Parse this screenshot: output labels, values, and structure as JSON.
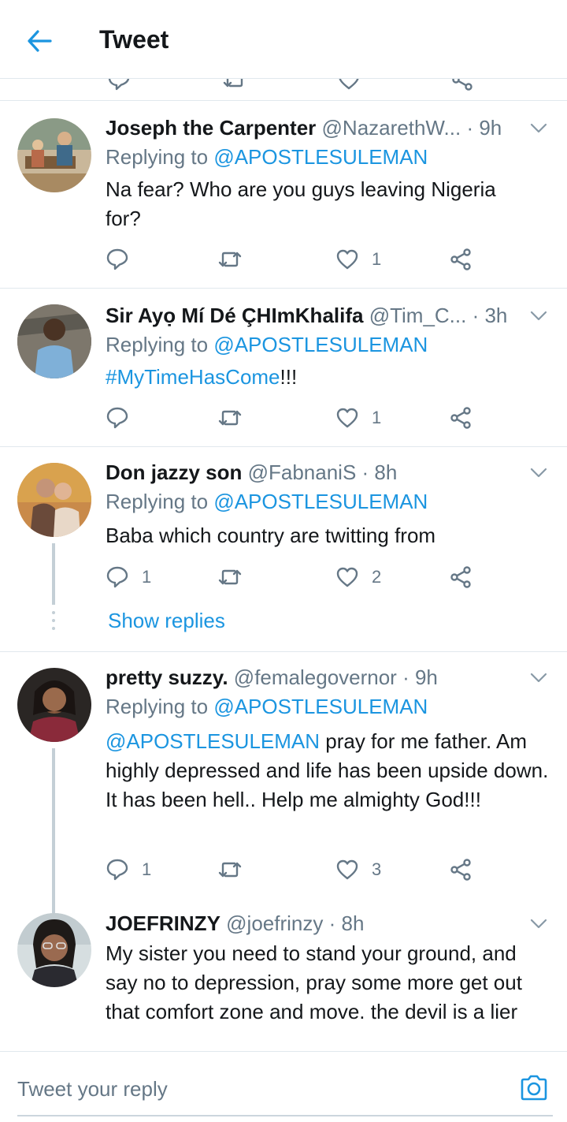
{
  "header": {
    "title": "Tweet",
    "back_icon": "arrow-left-icon",
    "accent": "#1b95e0"
  },
  "tweets": [
    {
      "name": "Joseph the Carpenter",
      "handle": "@NazarethW...",
      "time": "· 9h",
      "replying_prefix": "Replying to",
      "replying_to": "@APOSTLESULEMAN",
      "text": "Na fear? Who are you guys leaving Nigeria for?",
      "replies": "",
      "retweets": "",
      "likes": "1"
    },
    {
      "name": "Sir Ayọ Mí Dé ÇHImKhalifa",
      "handle": "@Tim_C...",
      "time": "· 3h",
      "replying_prefix": "Replying to",
      "replying_to": "@APOSTLESULEMAN",
      "hashtag": "#MyTimeHasCome",
      "text_suffix": "!!!",
      "replies": "",
      "retweets": "",
      "likes": "1"
    },
    {
      "name": "Don jazzy son",
      "handle": "@FabnaniS",
      "time": "· 8h",
      "replying_prefix": "Replying to",
      "replying_to": "@APOSTLESULEMAN",
      "text": "Baba which country are twitting from",
      "replies": "1",
      "retweets": "",
      "likes": "2",
      "show_replies": "Show replies"
    },
    {
      "name": "pretty suzzy.",
      "handle": "@femalegovernor",
      "time": "· 9h",
      "replying_prefix": "Replying to",
      "replying_to": "@APOSTLESULEMAN",
      "mention": "@APOSTLESULEMAN",
      "text": " pray for me father. Am highly depressed and life has been upside down. It has been hell.. Help me almighty God!!!",
      "replies": "1",
      "retweets": "",
      "likes": "3"
    },
    {
      "name": "JOEFRINZY",
      "handle": "@joefrinzy",
      "time": "· 8h",
      "text": "My sister you need to stand your ground, and say no to depression, pray some more get out that comfort zone and move. the devil is a lier"
    }
  ],
  "composer": {
    "placeholder": "Tweet your reply",
    "camera_icon": "camera-icon"
  },
  "colors": {
    "text": "#14171a",
    "secondary": "#657786",
    "link": "#1b95e0",
    "divider": "#e1e8ed"
  }
}
